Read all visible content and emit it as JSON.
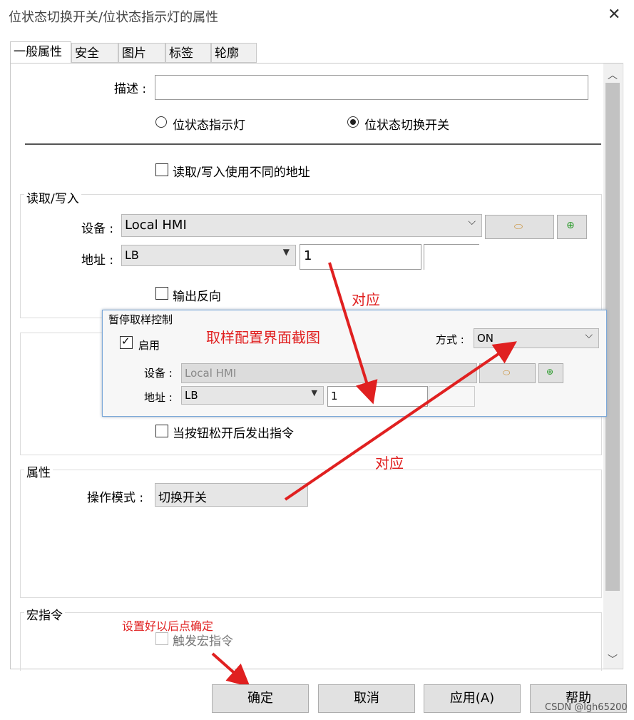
{
  "window": {
    "title": "位状态切换开关/位状态指示灯的属性",
    "close": "✕"
  },
  "tabs": [
    "一般属性",
    "安全",
    "图片",
    "标签",
    "轮廓"
  ],
  "general": {
    "desc_label": "描述 :",
    "desc_value": "",
    "radio_lamp": "位状态指示灯",
    "radio_switch": "位状态切换开关",
    "diff_addr_label": "读取/写入使用不同的地址"
  },
  "rw": {
    "group_label": "读取/写入",
    "device_label": "设备 :",
    "device_value": "Local HMI",
    "addr_label": "地址 :",
    "addr_type": "LB",
    "addr_value": "1",
    "invert_label": "输出反向"
  },
  "pause": {
    "title": "暂停取样控制",
    "enable_label": "启用",
    "mode_label": "方式 :",
    "mode_value": "ON",
    "device_label": "设备 :",
    "device_value": "Local HMI",
    "addr_label": "地址 :",
    "addr_type": "LB",
    "addr_value": "1"
  },
  "release_label": "当按钮松开后发出指令",
  "attr": {
    "group_label": "属性",
    "mode_label": "操作模式 :",
    "mode_value": "切换开关"
  },
  "macro": {
    "group_label": "宏指令",
    "trigger_label": "触发宏指令"
  },
  "annotations": {
    "screenshot_note": "取样配置界面截图",
    "map1": "对应",
    "map2": "对应",
    "confirm_note": "设置好以后点确定"
  },
  "buttons": {
    "ok": "确定",
    "cancel": "取消",
    "apply": "应用(A)",
    "help": "帮助"
  },
  "watermark": "CSDN @lgh65200",
  "colors": {
    "annotation": "#e02020",
    "overlay_border": "#7aa7d8"
  }
}
